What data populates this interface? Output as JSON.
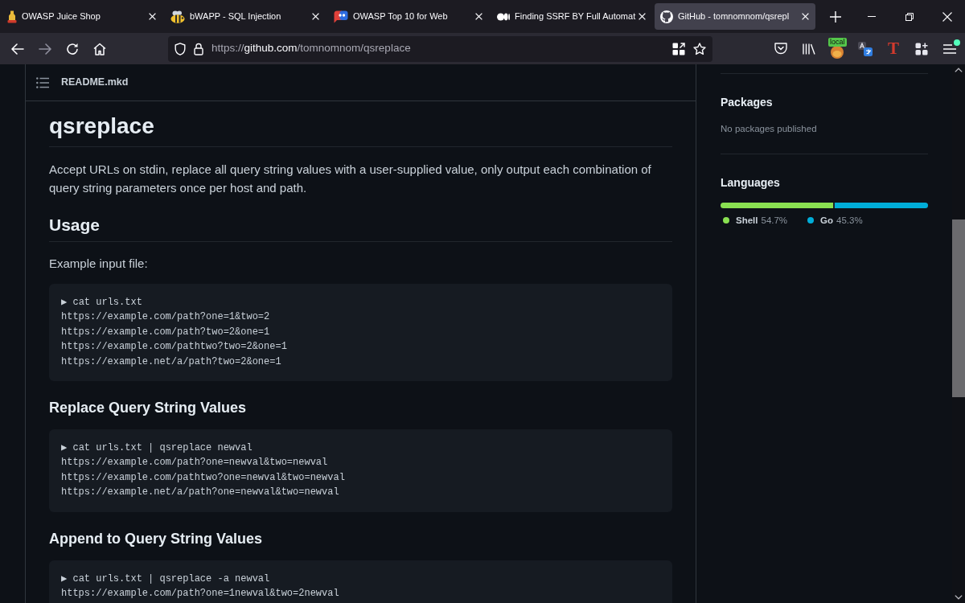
{
  "browser": {
    "tabs": [
      {
        "kind": "bottle",
        "title": "OWASP Juice Shop",
        "selected": false
      },
      {
        "kind": "bee",
        "title": "bWAPP - SQL Injection",
        "selected": false
      },
      {
        "kind": "chat",
        "title": "OWASP Top 10 for Web",
        "selected": false
      },
      {
        "kind": "dots",
        "title": "Finding SSRF BY Full Automat",
        "selected": false
      },
      {
        "kind": "cat",
        "title": "GitHub - tomnomnom/qsrepl",
        "selected": true
      }
    ],
    "nav_buttons": [
      {
        "kind": "back",
        "disabled": false
      },
      {
        "kind": "forward",
        "disabled": true
      },
      {
        "kind": "reload",
        "disabled": false
      },
      {
        "kind": "home",
        "disabled": false
      }
    ],
    "address": {
      "scheme": "https://",
      "host": "github.com",
      "path": "/tomnomnom/qsreplace"
    },
    "toolbar_items": [
      {
        "kind": "pocket"
      },
      {
        "kind": "library"
      },
      {
        "kind": "badge",
        "badge": "local"
      },
      {
        "kind": "translate"
      },
      {
        "kind": "letter",
        "glyph": "T"
      },
      {
        "kind": "extensions"
      },
      {
        "kind": "menu",
        "notification": true
      }
    ]
  },
  "readme": {
    "file_name": "README.mkd",
    "title": "qsreplace",
    "blocks": [
      {
        "kind": "paragraph",
        "text": "Accept URLs on stdin, replace all query string values with a user-supplied value, only output each combination of query string parameters once per host and path."
      },
      {
        "kind": "heading2",
        "text": "Usage"
      },
      {
        "kind": "paragraph",
        "text": "Example input file:"
      },
      {
        "kind": "code",
        "lines": [
          "▶ cat urls.txt",
          "https://example.com/path?one=1&two=2",
          "https://example.com/path?two=2&one=1",
          "https://example.com/pathtwo?two=2&one=1",
          "https://example.net/a/path?two=2&one=1"
        ]
      },
      {
        "kind": "heading3",
        "text": "Replace Query String Values"
      },
      {
        "kind": "code",
        "lines": [
          "▶ cat urls.txt | qsreplace newval",
          "https://example.com/path?one=newval&two=newval",
          "https://example.com/pathtwo?one=newval&two=newval",
          "https://example.net/a/path?one=newval&two=newval"
        ]
      },
      {
        "kind": "heading3",
        "text": "Append to Query String Values"
      },
      {
        "kind": "code",
        "lines": [
          "▶ cat urls.txt | qsreplace -a newval",
          "https://example.com/path?one=1newval&two=2newval"
        ]
      }
    ]
  },
  "sidebar": {
    "packages": {
      "title": "Packages",
      "note": "No packages published"
    },
    "languages": {
      "title": "Languages",
      "items": [
        {
          "name": "Shell",
          "percent": "54.7%",
          "level": 0.547,
          "color": "#89e051"
        },
        {
          "name": "Go",
          "percent": "45.3%",
          "level": 0.453,
          "color": "#00add8"
        }
      ]
    }
  }
}
